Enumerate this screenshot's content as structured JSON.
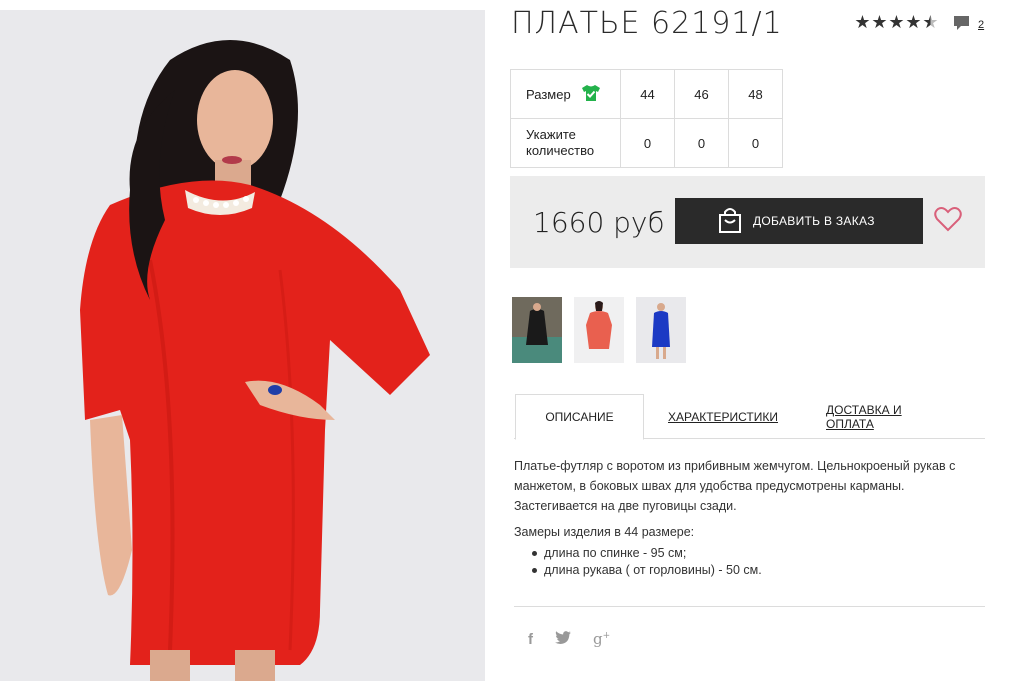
{
  "product": {
    "title": "ПЛАТЬЕ 62191/1",
    "rating": {
      "stars": 4.5,
      "max": 5
    },
    "comments_count": "2"
  },
  "sizes": {
    "size_label": "Размер",
    "quantity_label": "Укажите количество",
    "values": [
      "44",
      "46",
      "48"
    ],
    "quantities": [
      "0",
      "0",
      "0"
    ]
  },
  "purchase": {
    "price": "1660 руб",
    "add_label": "ДОБАВИТЬ В ЗАКАЗ"
  },
  "tabs": [
    {
      "label": "ОПИСАНИЕ",
      "active": true
    },
    {
      "label": "ХАРАКТЕРИСТИКИ",
      "active": false
    },
    {
      "label": "ДОСТАВКА И ОПЛАТА",
      "active": false
    }
  ],
  "description": {
    "text": "Платье-футляр с воротом из прибивным жемчугом. Цельнокроеный рукав с манжетом, в боковых швах для удобства предусмотрены карманы. Застегивается на две пуговицы сзади.",
    "measure_title": "Замеры изделия в 44 размере:",
    "measures": [
      "длина по спинке - 95 см;",
      "длина рукава ( от горловины) - 50 см."
    ]
  },
  "social": [
    "f",
    "twitter",
    "g+"
  ],
  "colors": {
    "dress": "#e3221b",
    "button": "#2a2a2a",
    "heart": "#d9607a",
    "check": "#23b24b"
  },
  "icons": [
    "star-icon",
    "comment-icon",
    "check-shirt-icon",
    "bag-icon",
    "heart-icon",
    "facebook-icon",
    "twitter-icon",
    "google-plus-icon"
  ]
}
